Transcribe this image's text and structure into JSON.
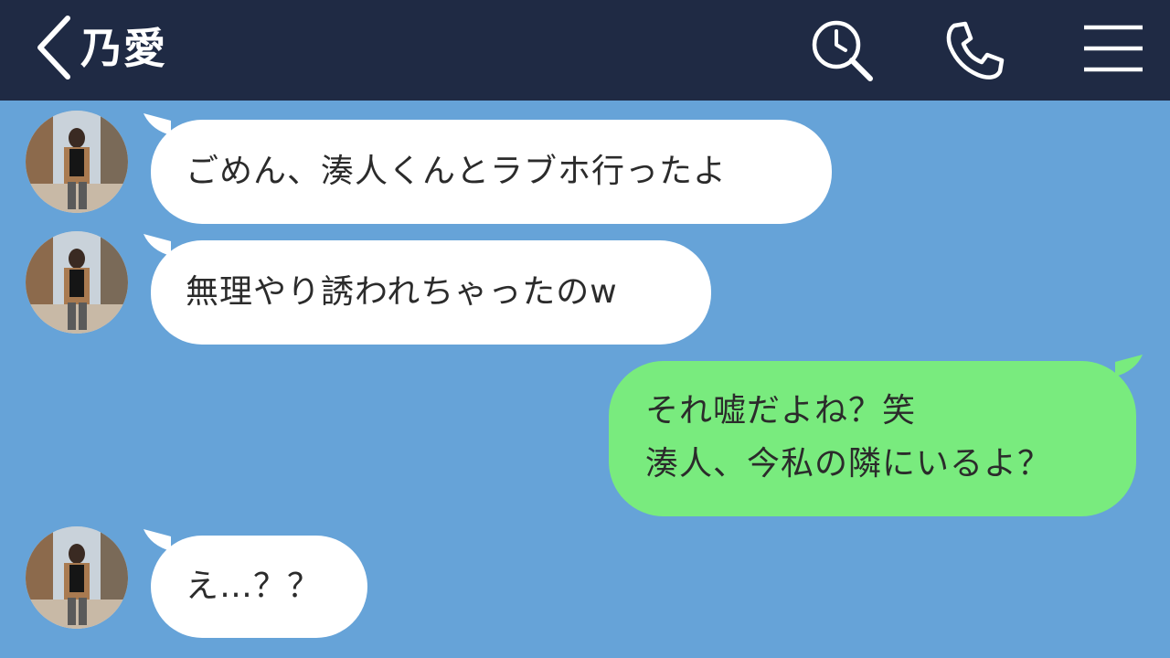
{
  "header": {
    "title": "乃愛",
    "back_icon": "chevron-left-icon",
    "search_icon": "search-history-icon",
    "call_icon": "phone-icon",
    "menu_icon": "hamburger-menu-icon",
    "bg_color": "#1F2A44"
  },
  "chat": {
    "bg_color": "#66A3D8",
    "messages": [
      {
        "sender": "乃愛",
        "direction": "incoming",
        "lines": [
          "ごめん、湊人くんとラブホ行ったよ"
        ]
      },
      {
        "sender": "乃愛",
        "direction": "incoming",
        "lines": [
          "無理やり誘われちゃったのw"
        ]
      },
      {
        "sender": "me",
        "direction": "outgoing",
        "lines": [
          "それ嘘だよね？笑",
          "湊人、今私の隣にいるよ？"
        ]
      },
      {
        "sender": "乃愛",
        "direction": "incoming",
        "lines": [
          "え…？？"
        ]
      }
    ],
    "incoming_color": "#FFFFFF",
    "outgoing_color": "#79EB7E"
  }
}
